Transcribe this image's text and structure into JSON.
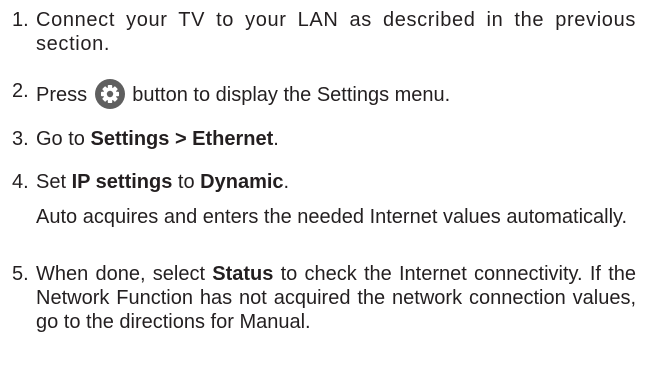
{
  "steps": [
    {
      "number": "1.",
      "text": "Connect your TV to your LAN as described in the previous section."
    },
    {
      "number": "2.",
      "text_before_icon": "Press",
      "icon": "gear-settings-icon",
      "text_after_icon": "button to display the Settings menu."
    },
    {
      "number": "3.",
      "prefix": "Go to ",
      "bold": "Settings > Ethernet",
      "suffix": "."
    },
    {
      "number": "4.",
      "prefix": "Set ",
      "bold1": "IP settings",
      "middle": " to ",
      "bold2": "Dynamic",
      "suffix": ".",
      "note": "Auto acquires and enters the needed Internet values automatically."
    },
    {
      "number": "5.",
      "prefix": "When done, select ",
      "bold": "Status",
      "suffix": " to check the Internet connectivity. If the Network Function has not acquired the network connection values, go to the directions for Manual."
    }
  ],
  "colors": {
    "text": "#231f20",
    "icon_fill": "#5f5f5f"
  }
}
